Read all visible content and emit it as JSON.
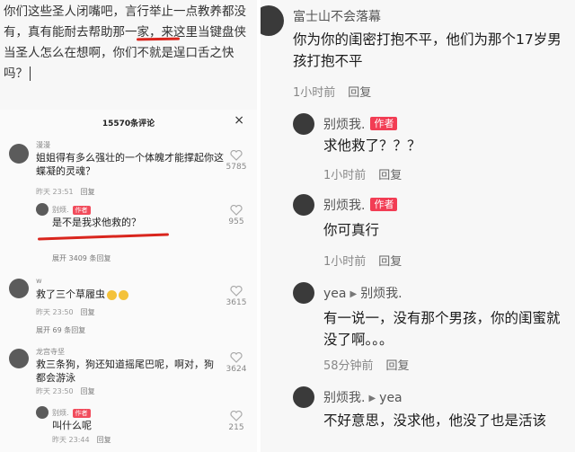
{
  "left": {
    "typed_text": "你们这些圣人闭嘴吧，言行举止一点教养都没有，真有能耐去帮助那一家，来这里当键盘侠当圣人怎么在想啊，你们不就是逞口舌之快吗？",
    "sheet_title": "15570条评论",
    "close_icon": "×",
    "comments": [
      {
        "user": "漫漫",
        "text": "姐姐得有多么强壮的一个体魄才能撑起你这蝶凝的灵魂？",
        "time": "昨天 23:51",
        "reply": "回复",
        "likes": "5785"
      },
      {
        "user": "别烦.",
        "tag": "作者",
        "text": "是不是我求他救的？",
        "time": "",
        "reply": "",
        "likes": "955"
      },
      {
        "expand": "展开 3409 条回复"
      },
      {
        "user": "w",
        "text": "救了三个草履虫",
        "time": "昨天 23:50",
        "reply": "回复",
        "likes": "3615"
      },
      {
        "expand": "展开 69 条回复"
      },
      {
        "user": "龙宫寺坚",
        "text": "救三条狗，狗还知道摇尾巴呢，啊对，狗都会游泳",
        "time": "昨天 23:50",
        "reply": "回复",
        "likes": "3624"
      },
      {
        "user": "别烦.",
        "tag": "作者",
        "text": "叫什么呢",
        "time": "昨天 23:44",
        "reply": "回复",
        "likes": "215"
      }
    ]
  },
  "right": {
    "comments": [
      {
        "user": "富士山不会落幕",
        "text": "你为你的闺密打抱不平，他们为那个17岁男孩打抱不平",
        "time": "1小时前",
        "reply": "回复"
      },
      {
        "user": "别烦我.",
        "tag": "作者",
        "text": "求他救了？？？",
        "time": "1小时前",
        "reply": "回复"
      },
      {
        "user": "别烦我.",
        "tag": "作者",
        "text": "你可真行",
        "time": "1小时前",
        "reply": "回复"
      },
      {
        "user": "yea",
        "reply_to": "别烦我.",
        "text": "有一说一，没有那个男孩，你的闺蜜就没了啊。。。",
        "time": "58分钟前",
        "reply": "回复"
      },
      {
        "user": "别烦我.",
        "reply_to": "yea",
        "text": "不好意思，没求他，他没了也是活该",
        "time": "",
        "reply": ""
      }
    ]
  },
  "colors": {
    "author_tag": "#f23d54",
    "underline": "#d9251d"
  }
}
